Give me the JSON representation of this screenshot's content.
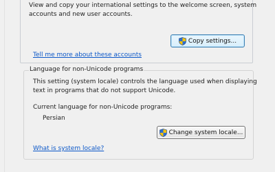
{
  "welcome_section": {
    "description_line1": "View and copy your international settings to the welcome screen, system",
    "description_line2": "accounts and new user accounts.",
    "copy_button_label": "Copy settings...",
    "more_link": "Tell me more about these accounts"
  },
  "non_unicode_section": {
    "group_title": "Language for non-Unicode programs",
    "description_line1": "This setting (system locale) controls the language used when displaying",
    "description_line2": "text in programs that do not support Unicode.",
    "current_label": "Current language for non-Unicode programs:",
    "current_value": "Persian",
    "change_button_label": "Change system locale...",
    "what_link": "What is system locale?"
  },
  "icons": {
    "copy_button_icon": "uac-shield-icon",
    "change_button_icon": "uac-shield-icon"
  }
}
